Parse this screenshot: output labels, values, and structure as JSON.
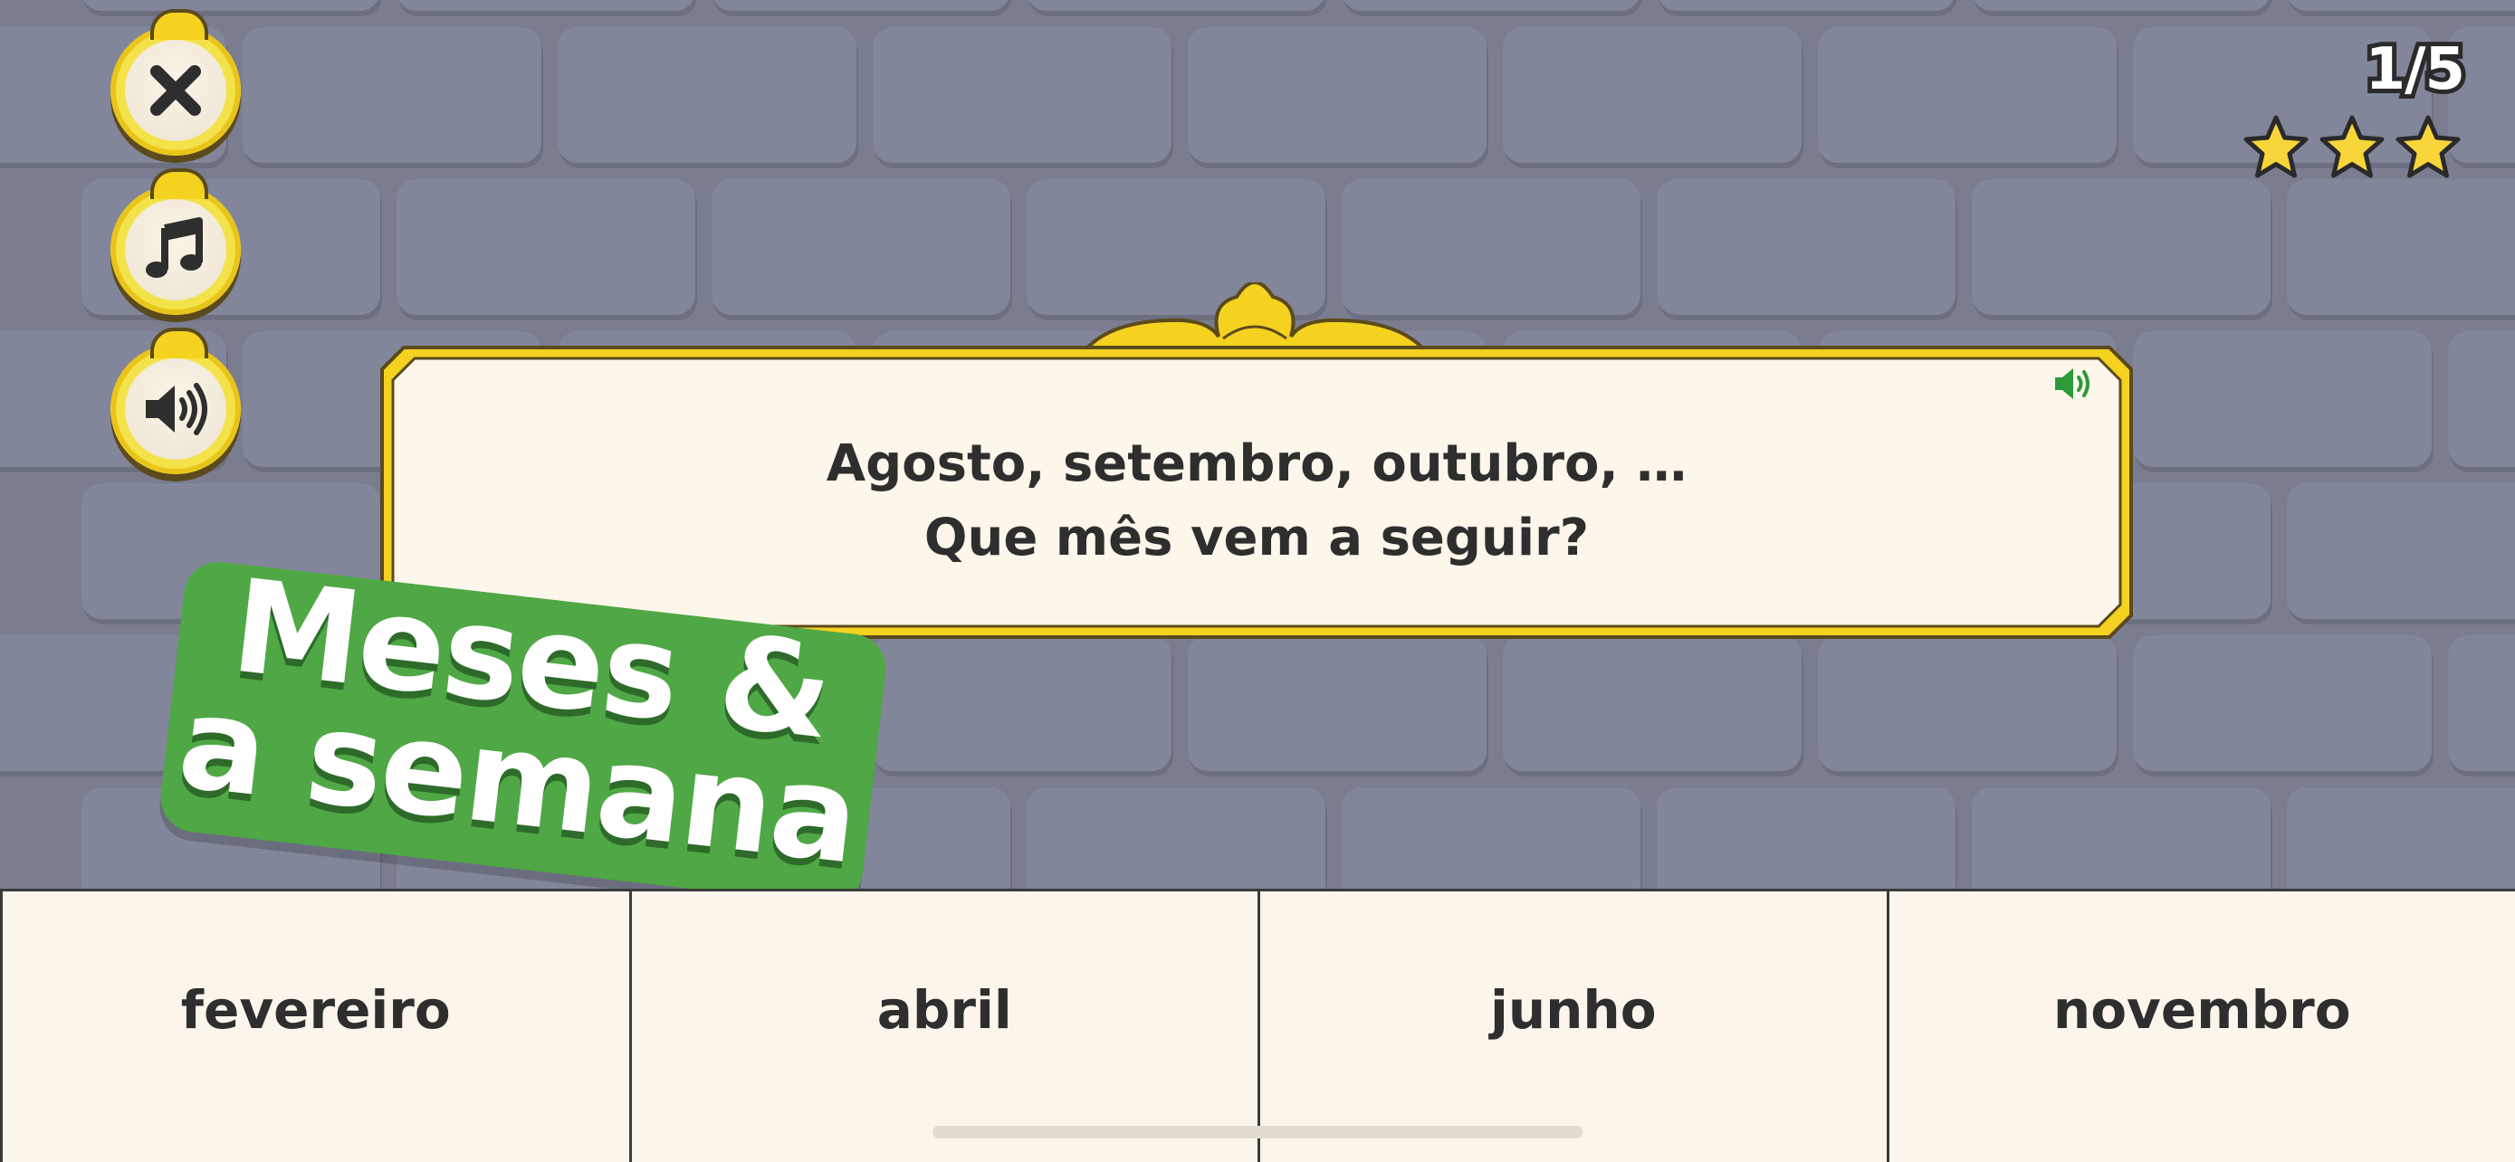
{
  "header": {
    "progress": "1/5",
    "stars": [
      {
        "filled": true
      },
      {
        "filled": true
      },
      {
        "filled": true
      }
    ]
  },
  "side_buttons": {
    "close_icon": "close-icon",
    "music_icon": "music-note-icon",
    "sound_icon": "speaker-icon"
  },
  "question": {
    "line1": "Agosto, setembro, outubro, …",
    "line2": "Que mês vem a seguir?",
    "audio_icon": "speaker-icon"
  },
  "badge": {
    "line1": "Meses &",
    "line2": "a semana"
  },
  "answers": [
    {
      "label": "fevereiro"
    },
    {
      "label": "abril"
    },
    {
      "label": "junho"
    },
    {
      "label": "novembro"
    }
  ],
  "colors": {
    "wall": "#7a7d8f",
    "brick": "#82869a",
    "gold": "#f4d21f",
    "card": "#fdf6ea",
    "badge_green": "#4fa845",
    "answer_bg": "#fcf5eb",
    "audio_green": "#2a9a3a"
  }
}
